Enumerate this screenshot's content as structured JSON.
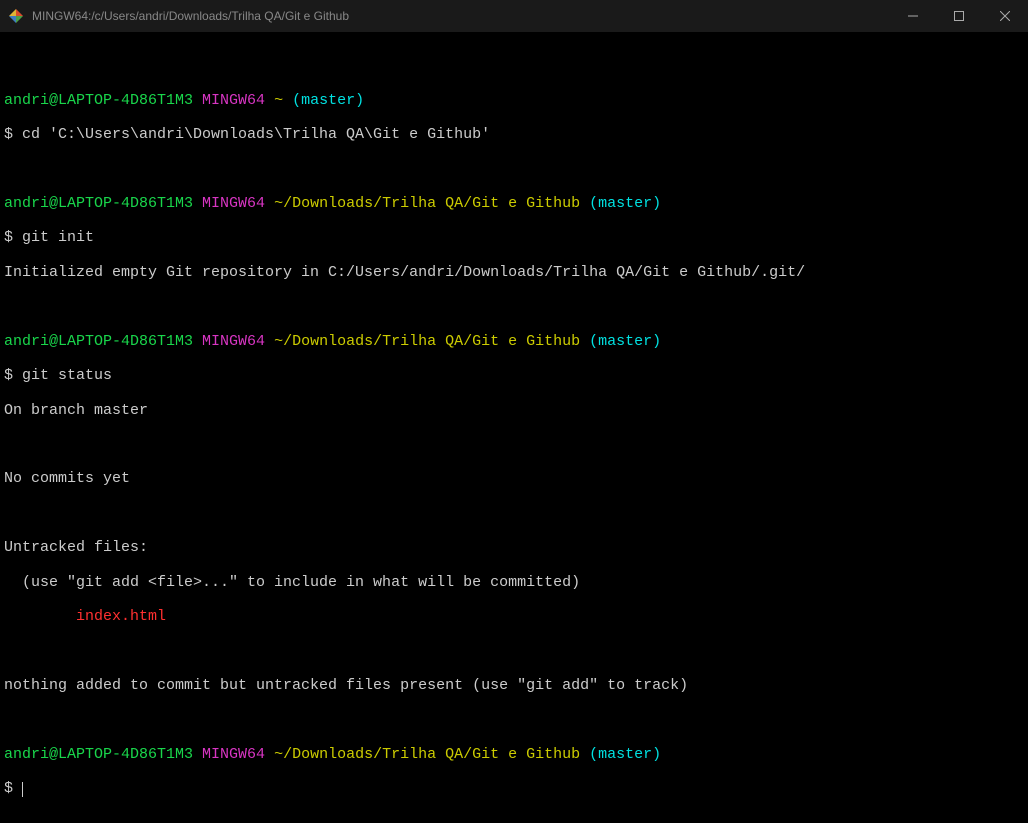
{
  "titlebar": {
    "title": "MINGW64:/c/Users/andri/Downloads/Trilha QA/Git e Github"
  },
  "prompt1": {
    "user": "andri@LAPTOP-4D86T1M3",
    "env": "MINGW64",
    "path": "~",
    "branch": "(master)"
  },
  "cmd1": "$ cd 'C:\\Users\\andri\\Downloads\\Trilha QA\\Git e Github'",
  "prompt2": {
    "user": "andri@LAPTOP-4D86T1M3",
    "env": "MINGW64",
    "path": "~/Downloads/Trilha QA/Git e Github",
    "branch": "(master)"
  },
  "cmd2": "$ git init",
  "out2": "Initialized empty Git repository in C:/Users/andri/Downloads/Trilha QA/Git e Github/.git/",
  "prompt3": {
    "user": "andri@LAPTOP-4D86T1M3",
    "env": "MINGW64",
    "path": "~/Downloads/Trilha QA/Git e Github",
    "branch": "(master)"
  },
  "cmd3": "$ git status",
  "status": {
    "l1": "On branch master",
    "l2": "No commits yet",
    "l3": "Untracked files:",
    "l4": "  (use \"git add <file>...\" to include in what will be committed)",
    "l5_indent": "        ",
    "l5_file": "index.html",
    "l6": "nothing added to commit but untracked files present (use \"git add\" to track)"
  },
  "prompt4": {
    "user": "andri@LAPTOP-4D86T1M3",
    "env": "MINGW64",
    "path": "~/Downloads/Trilha QA/Git e Github",
    "branch": "(master)"
  },
  "cmd4": "$"
}
